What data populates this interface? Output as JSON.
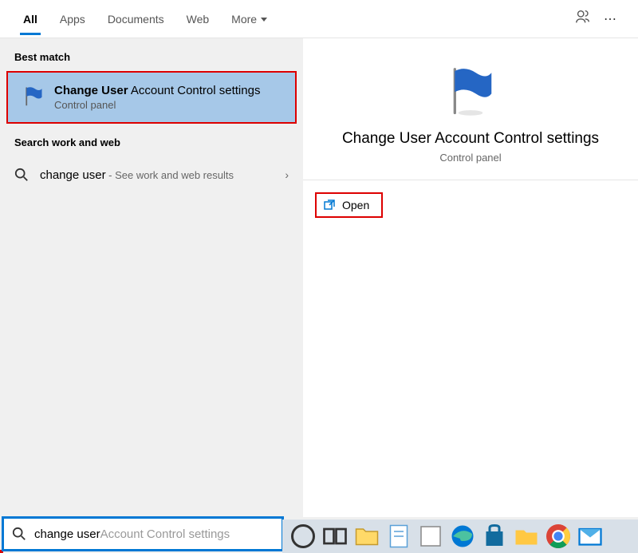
{
  "tabs": {
    "items": [
      "All",
      "Apps",
      "Documents",
      "Web",
      "More"
    ],
    "active": 0
  },
  "left": {
    "best_match_label": "Best match",
    "result": {
      "title_bold": "Change User",
      "title_rest": " Account Control settings",
      "sub": "Control panel"
    },
    "web_label": "Search work and web",
    "web_row": {
      "query": "change user",
      "suffix": " - See work and web results"
    }
  },
  "detail": {
    "title": "Change User Account Control settings",
    "sub": "Control panel",
    "open": "Open"
  },
  "search": {
    "typed": "change user",
    "suggest": " Account Control settings"
  }
}
